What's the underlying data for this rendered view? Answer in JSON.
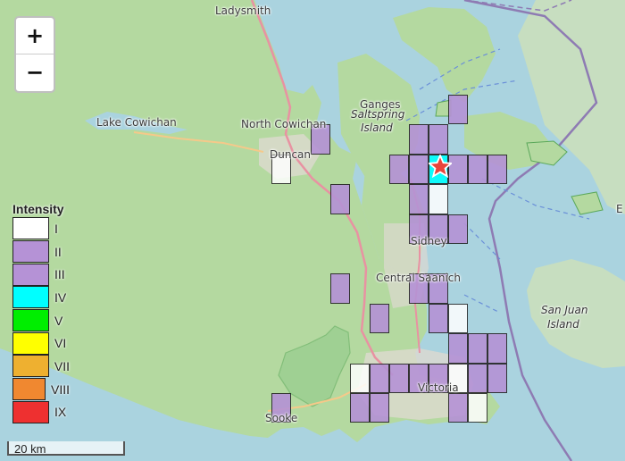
{
  "colors": {
    "water": "#aad3df",
    "land": "#f2efe9",
    "forest": "#add19e",
    "road": "#e892a2",
    "border": "#8e7bb3",
    "intensity": {
      "I": "#ffffff",
      "II": "#b592d6",
      "III": "#b592d6",
      "IV": "#00ffff",
      "V": "#00ee00",
      "VI": "#ffff00",
      "VII": "#eeb030",
      "VIII": "#f08830",
      "IX": "#ee3030"
    }
  },
  "places": {
    "ladysmith": "Ladysmith",
    "ganges": "Ganges",
    "saltspring": "Saltspring",
    "island": "Island",
    "lake_cowichan": "Lake Cowichan",
    "north_cowichan": "North Cowichan",
    "duncan": "Duncan",
    "sidney": "Sidney",
    "central_saanich": "Central Saanich",
    "san_juan": "San Juan",
    "san_juan_island": "Island",
    "victoria": "Victoria",
    "sooke": "Sooke",
    "edge_e": "E"
  },
  "controls": {
    "zoom_in": "+",
    "zoom_out": "−"
  },
  "legend": {
    "title": "Intensity",
    "items": [
      "I",
      "II",
      "III",
      "IV",
      "V",
      "VI",
      "VII",
      "VIII",
      "IX"
    ]
  },
  "scale": "20 km",
  "icons": {
    "epicenter": "star-icon"
  },
  "intensity_cells": [
    {
      "col": 6,
      "row": 0,
      "level": "III"
    },
    {
      "col": -1,
      "row": 1,
      "level": "III"
    },
    {
      "col": 4,
      "row": 1,
      "level": "II"
    },
    {
      "col": 5,
      "row": 1,
      "level": "III"
    },
    {
      "col": -3,
      "row": 2,
      "level": "I"
    },
    {
      "col": 3,
      "row": 2,
      "level": "III"
    },
    {
      "col": 4,
      "row": 2,
      "level": "III"
    },
    {
      "col": 5,
      "row": 2,
      "level": "IV"
    },
    {
      "col": 6,
      "row": 2,
      "level": "III"
    },
    {
      "col": 7,
      "row": 2,
      "level": "III"
    },
    {
      "col": 8,
      "row": 2,
      "level": "III"
    },
    {
      "col": 0,
      "row": 3,
      "level": "III"
    },
    {
      "col": 4,
      "row": 3,
      "level": "III"
    },
    {
      "col": 5,
      "row": 3,
      "level": "I"
    },
    {
      "col": 4,
      "row": 4,
      "level": "III"
    },
    {
      "col": 5,
      "row": 4,
      "level": "III"
    },
    {
      "col": 6,
      "row": 4,
      "level": "III"
    },
    {
      "col": 4,
      "row": 6,
      "level": "III"
    },
    {
      "col": 5,
      "row": 6,
      "level": "III"
    },
    {
      "col": 0,
      "row": 6,
      "level": "III"
    },
    {
      "col": 2,
      "row": 7,
      "level": "III"
    },
    {
      "col": 5,
      "row": 7,
      "level": "III"
    },
    {
      "col": 6,
      "row": 7,
      "level": "I"
    },
    {
      "col": 6,
      "row": 8,
      "level": "III"
    },
    {
      "col": 7,
      "row": 8,
      "level": "III"
    },
    {
      "col": 8,
      "row": 8,
      "level": "III"
    },
    {
      "col": 1,
      "row": 9,
      "level": "I"
    },
    {
      "col": 2,
      "row": 9,
      "level": "III"
    },
    {
      "col": 3,
      "row": 9,
      "level": "III"
    },
    {
      "col": 4,
      "row": 9,
      "level": "III"
    },
    {
      "col": 5,
      "row": 9,
      "level": "III"
    },
    {
      "col": 6,
      "row": 9,
      "level": "I"
    },
    {
      "col": 7,
      "row": 9,
      "level": "III"
    },
    {
      "col": 8,
      "row": 9,
      "level": "III"
    },
    {
      "col": 1,
      "row": 10,
      "level": "III"
    },
    {
      "col": 2,
      "row": 10,
      "level": "III"
    },
    {
      "col": 6,
      "row": 10,
      "level": "III"
    },
    {
      "col": 7,
      "row": 10,
      "level": "I"
    },
    {
      "col": -3,
      "row": 10,
      "level": "III"
    }
  ]
}
